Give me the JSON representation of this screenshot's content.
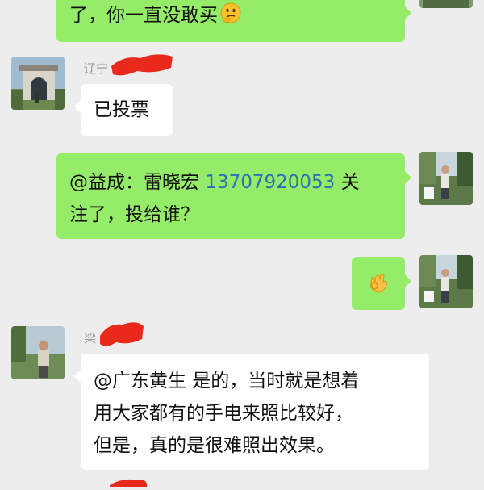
{
  "colors": {
    "background": "#ededed",
    "bubble_self": "#95ec69",
    "bubble_other": "#ffffff",
    "sender_name": "#9a9a9a",
    "phone_link": "#2b6fb6",
    "redaction": "#e8291c"
  },
  "messages": [
    {
      "id": "m1",
      "side": "right",
      "line1": "了，你一直没敢买",
      "emoji_icon": "thinking-face-emoji"
    },
    {
      "id": "m2",
      "side": "left",
      "sender": "辽宁",
      "text": "已投票",
      "sender_redacted": true
    },
    {
      "id": "m3",
      "side": "right",
      "mention": "@益成：雷晓宏 ",
      "phone": "13707920053",
      "line1_tail": " 关",
      "line2": "注了，投给谁？"
    },
    {
      "id": "m4",
      "side": "right",
      "emoji_icon": "ok-hand-emoji"
    },
    {
      "id": "m5",
      "side": "left",
      "sender": "梁",
      "line1": "@广东黄生  是的，当时就是想着",
      "line2": "用大家都有的手电来照比较好，",
      "line3": "但是，真的是很难照出效果。",
      "sender_redacted": true
    }
  ]
}
